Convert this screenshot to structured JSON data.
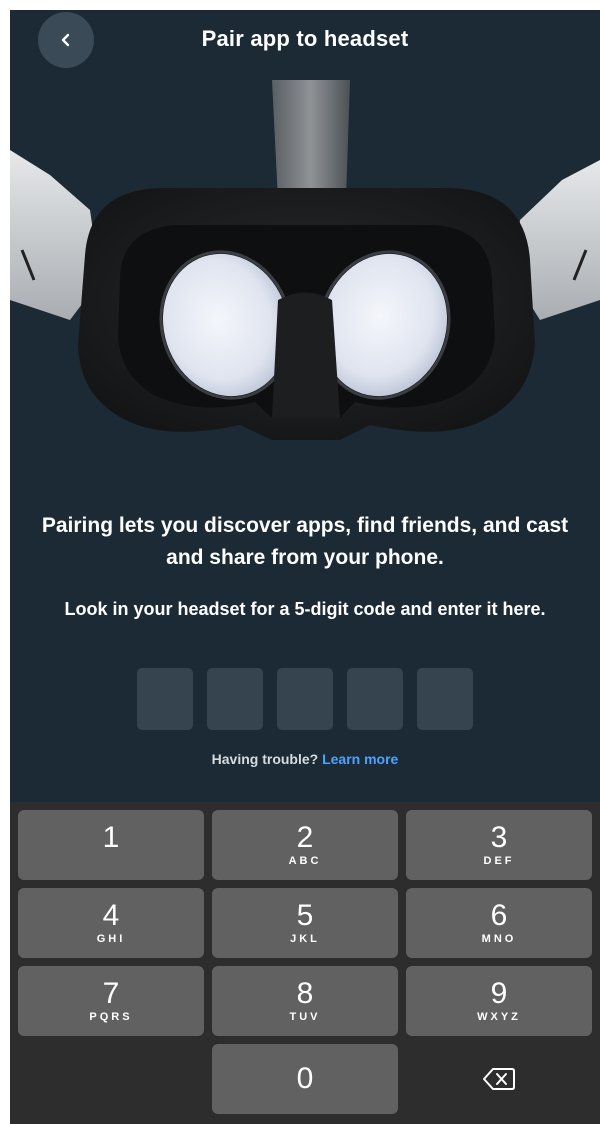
{
  "header": {
    "title": "Pair app to headset",
    "back_icon": "chevron-left-icon"
  },
  "content": {
    "lead": "Pairing lets you discover apps, find friends, and cast and share from your phone.",
    "instruction": "Look in your headset for a 5-digit code and enter it here.",
    "code_length": 5,
    "trouble_text": "Having trouble?",
    "learn_more_link": "Learn more"
  },
  "keypad": {
    "rows": [
      [
        {
          "digit": "1",
          "letters": ""
        },
        {
          "digit": "2",
          "letters": "ABC"
        },
        {
          "digit": "3",
          "letters": "DEF"
        }
      ],
      [
        {
          "digit": "4",
          "letters": "GHI"
        },
        {
          "digit": "5",
          "letters": "JKL"
        },
        {
          "digit": "6",
          "letters": "MNO"
        }
      ],
      [
        {
          "digit": "7",
          "letters": "PQRS"
        },
        {
          "digit": "8",
          "letters": "TUV"
        },
        {
          "digit": "9",
          "letters": "WXYZ"
        }
      ]
    ],
    "zero": "0",
    "backspace_icon": "backspace-icon"
  },
  "colors": {
    "background": "#1b2a35",
    "link": "#4ea3ff",
    "code_box": "#36444f",
    "keypad_bg": "#2d2d2d",
    "key_bg": "#616161"
  }
}
